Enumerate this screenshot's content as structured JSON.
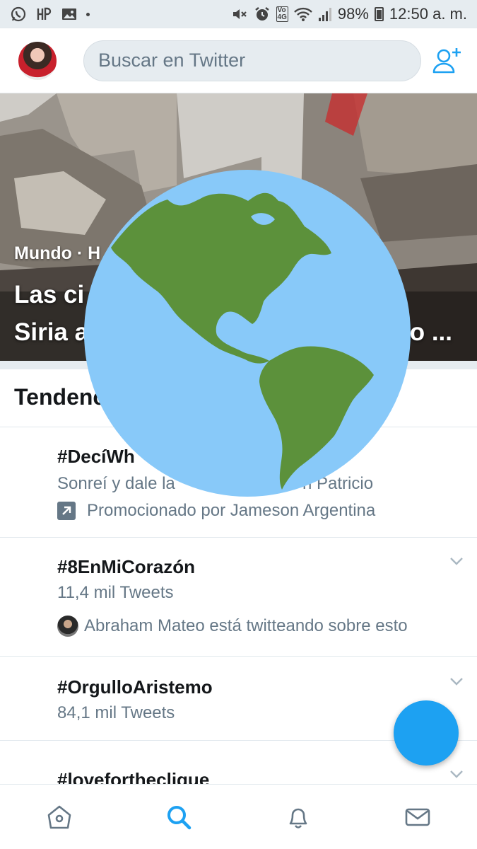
{
  "status_bar": {
    "battery": "98%",
    "time": "12:50 a. m.",
    "network": "4G",
    "volte": "VoLTE"
  },
  "header": {
    "search_placeholder": "Buscar en Twitter",
    "icons": [
      "avatar",
      "add-user-icon"
    ]
  },
  "hero": {
    "category": "Mundo · H",
    "title_line1": "Las ci",
    "title_line1_right": "",
    "title_line2": "Siria a",
    "title_line2_right": "o ..."
  },
  "trends": {
    "section_title": "Tendenc",
    "items": [
      {
        "name": "#DecíWh",
        "description": "Sonreí y dale la",
        "description_right": "n Patricio",
        "promoted_text": "Promocionado por Jameson Argentina"
      },
      {
        "name": "#8EnMiCorazón",
        "count": "11,4 mil Tweets",
        "context": "Abraham Mateo está twitteando sobre esto"
      },
      {
        "name": "#OrgulloAristemo",
        "count": "84,1 mil Tweets"
      },
      {
        "name": "#lovefortheclique"
      }
    ]
  },
  "tabbar": {
    "tabs": [
      "home-icon",
      "search-icon",
      "notifications-icon",
      "messages-icon"
    ],
    "active": "search-icon"
  },
  "colors": {
    "accent": "#1da1f2",
    "text_primary": "#14171a",
    "text_secondary": "#657786",
    "background_gray": "#e6ecf0",
    "globe_ocean": "#88c9f9",
    "globe_land": "#5c913b"
  }
}
